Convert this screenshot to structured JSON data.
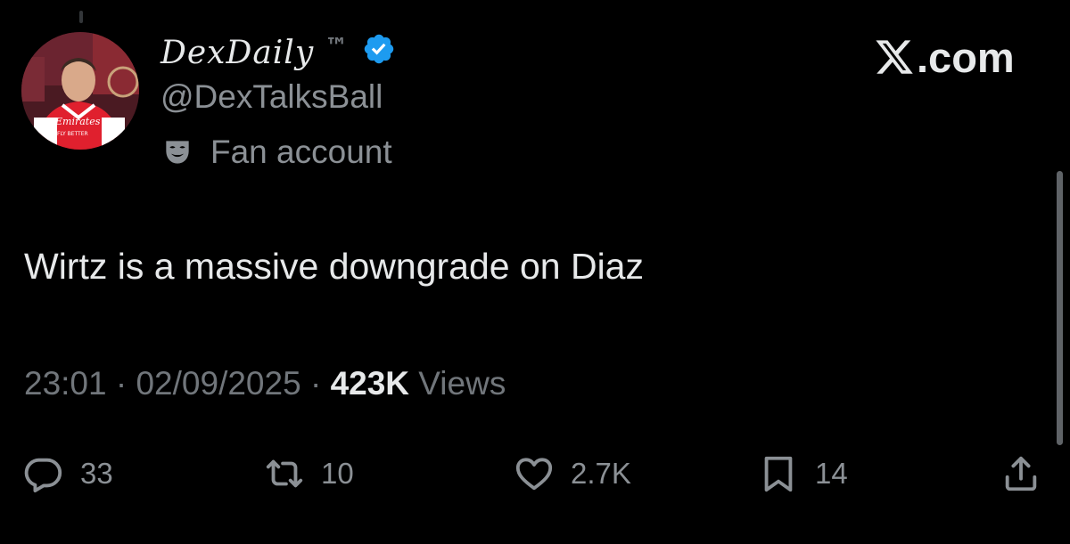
{
  "author": {
    "display_name": "DexDaily",
    "badge_text": "™",
    "handle": "@DexTalksBall",
    "account_label": "Fan account",
    "avatar_jersey_text": [
      "Emirates",
      "FLY BETTER"
    ]
  },
  "site": {
    "wordmark_text": ".com",
    "wordmark_icon": "x-logo-icon"
  },
  "tweet": {
    "text": "Wirtz is a massive downgrade on Diaz",
    "time": "23:01",
    "separator": "·",
    "date": "02/09/2025",
    "views_count": "423K",
    "views_label": "Views"
  },
  "actions": {
    "replies": "33",
    "reposts": "10",
    "likes": "2.7K",
    "bookmarks": "14"
  },
  "colors": {
    "background": "#000000",
    "primary_text": "#e7e9ea",
    "secondary_text": "#71767b",
    "verified": "#1d9bf0"
  }
}
